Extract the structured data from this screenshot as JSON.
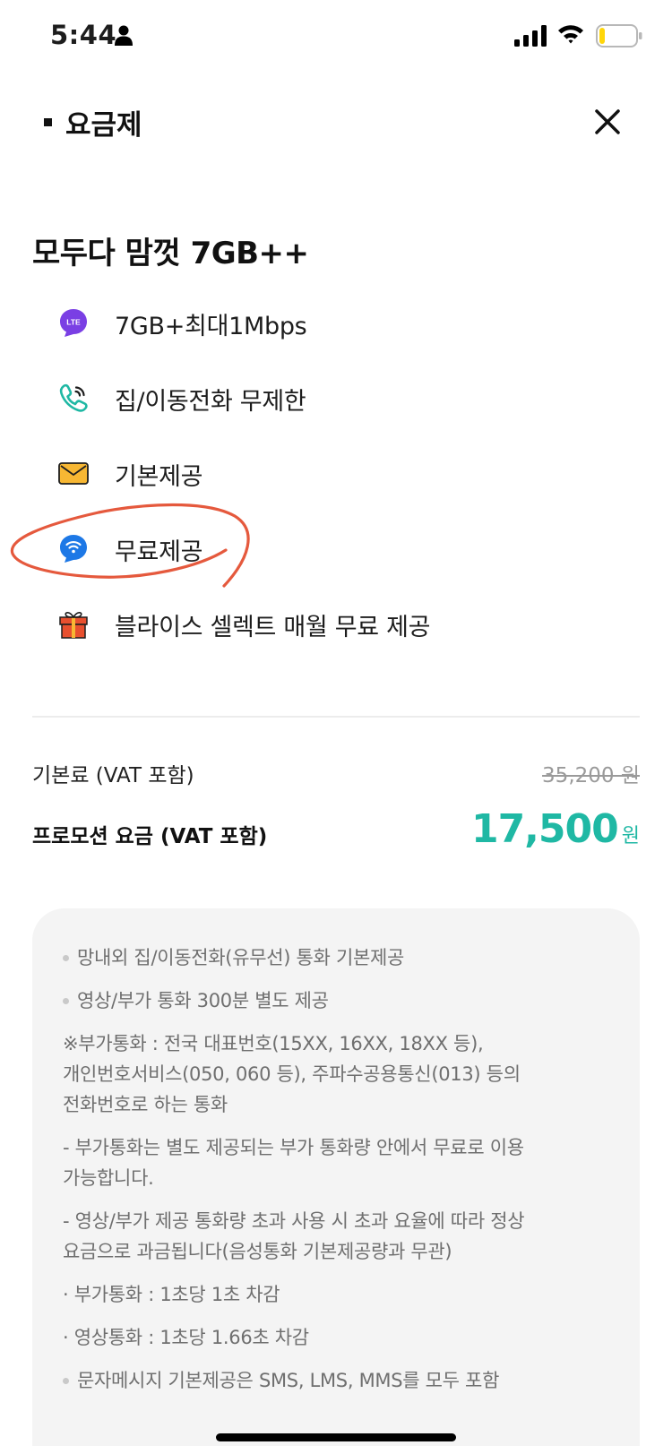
{
  "status_bar": {
    "time": "5:44"
  },
  "header": {
    "title": "요금제"
  },
  "plan": {
    "name": "모두다 맘껏 7GB++",
    "features": [
      {
        "icon": "lte-icon",
        "label": "7GB+최대1Mbps",
        "color": "#7a3fe4"
      },
      {
        "icon": "phone-icon",
        "label": "집/이동전화 무제한",
        "color": "#1fb8a4"
      },
      {
        "icon": "envelope-icon",
        "label": "기본제공",
        "color": "#f7b733"
      },
      {
        "icon": "wifi-icon",
        "label": "무료제공",
        "color": "#1d78e6"
      },
      {
        "icon": "gift-icon",
        "label": "블라이스 셀렉트 매월 무료 제공",
        "color": "#e8502f"
      }
    ]
  },
  "pricing": {
    "base_label": "기본료 (VAT 포함)",
    "base_value": "35,200 원",
    "promo_label": "프로모션 요금 (VAT 포함)",
    "promo_value": "17,500",
    "promo_unit": "원",
    "accent_color": "#1fb8a4"
  },
  "notes": [
    "망내외 집/이동전화(유무선) 통화 기본제공",
    "영상/부가 통화 300분 별도 제공",
    "※부가통화 : 전국 대표번호(15XX, 16XX, 18XX 등),\n개인번호서비스(050, 060 등), 주파수공용통신(013) 등의\n전화번호로 하는 통화",
    "- 부가통화는 별도 제공되는 부가 통화량 안에서 무료로 이용\n가능합니다.",
    "- 영상/부가 제공 통화량 초과 사용 시 초과 요율에 따라 정상\n요금으로 과금됩니다(음성통화 기본제공량과 무관)",
    "· 부가통화 : 1초당 1초 차감",
    "· 영상통화 : 1초당 1.66초 차감",
    "문자메시지 기본제공은 SMS, LMS, MMS를 모두 포함"
  ],
  "annotation_color": "#e5593d"
}
